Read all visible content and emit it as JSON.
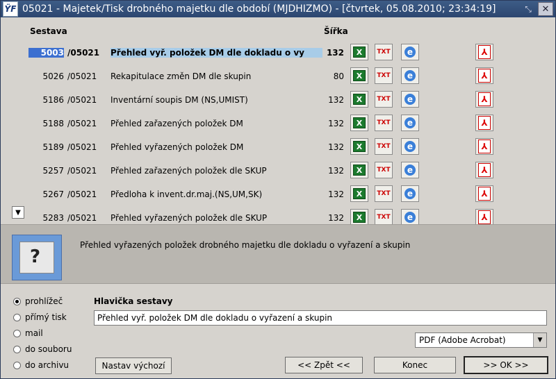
{
  "window": {
    "title": "05021 - Majetek/Tisk drobného majetku dle období (MJDHIZMO) - [čtvrtek, 05.08.2010; 23:34:19]",
    "app_icon": "ŸF"
  },
  "list": {
    "headers": {
      "report": "Sestava",
      "width": "Šířka"
    },
    "rows": [
      {
        "num": "5003",
        "sep": "/05021",
        "name": "Přehled vyř. položek DM dle dokladu o vy",
        "width": "132",
        "selected": true
      },
      {
        "num": "5026",
        "sep": "/05021",
        "name": "Rekapitulace změn DM dle skupin",
        "width": "80"
      },
      {
        "num": "5186",
        "sep": "/05021",
        "name": "Inventární soupis DM (NS,UMIST)",
        "width": "132"
      },
      {
        "num": "5188",
        "sep": "/05021",
        "name": "Přehled zařazených položek DM",
        "width": "132"
      },
      {
        "num": "5189",
        "sep": "/05021",
        "name": "Přehled vyřazených položek DM",
        "width": "132"
      },
      {
        "num": "5257",
        "sep": "/05021",
        "name": "Přehled zařazených položek dle SKUP",
        "width": "132"
      },
      {
        "num": "5267",
        "sep": "/05021",
        "name": "Předloha k invent.dr.maj.(NS,UM,SK)",
        "width": "132"
      },
      {
        "num": "5283",
        "sep": "/05021",
        "name": "Přehled vyřazených položek dle SKUP",
        "width": "132"
      }
    ],
    "icons": {
      "xls": "excel-icon",
      "txt": "txt-icon",
      "html": "ie-icon",
      "pdf": "pdf-icon"
    }
  },
  "description": "Přehled vyřazených položek drobného majetku dle dokladu o vyřazení a skupin",
  "output": {
    "options": [
      "prohlížeč",
      "přímý tisk",
      "mail",
      "do souboru",
      "do archivu"
    ],
    "selected_index": 0
  },
  "header_field": {
    "label": "Hlavička sestavy",
    "value": "Přehled vyř. položek DM dle dokladu o vyřazení a skupin"
  },
  "format_select": {
    "value": "PDF (Adobe Acrobat)"
  },
  "buttons": {
    "defaults": "Nastav výchozí",
    "back": "<< Zpět <<",
    "end": "Konec",
    "ok": ">> OK >>"
  }
}
